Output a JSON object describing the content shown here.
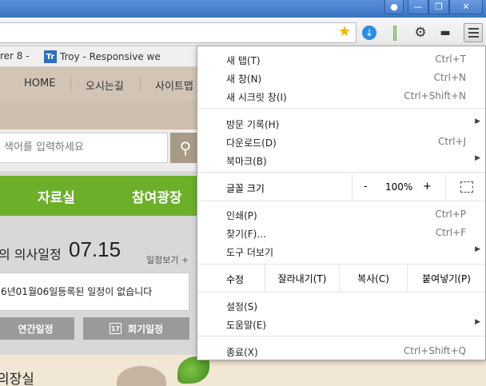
{
  "bookmarks": [
    {
      "label": "rer 8 -"
    },
    {
      "icon_text": "Tr",
      "label": "Troy - Responsive we"
    }
  ],
  "site": {
    "nav": [
      "HOME",
      "오시는길",
      "사이트맵"
    ],
    "search_placeholder": "색어를 입력하세요",
    "green_menu": [
      "자료실",
      "참여광장"
    ],
    "agenda": {
      "title": "의 의사일정",
      "date": "07.15",
      "more": "일정보기 +",
      "message": "6년01월06일등록된 일정이 없습니다",
      "btn_annual": "연간일정",
      "btn_session": "회기일정",
      "cal_num": "17"
    },
    "bottom_title": "의장실"
  },
  "menu": {
    "new_tab": {
      "label": "새 탭(T)",
      "shortcut": "Ctrl+T"
    },
    "new_window": {
      "label": "새 창(N)",
      "shortcut": "Ctrl+N"
    },
    "incognito": {
      "label": "새 시크릿 창(I)",
      "shortcut": "Ctrl+Shift+N"
    },
    "history": {
      "label": "방문 기록(H)"
    },
    "downloads": {
      "label": "다운로드(D)",
      "shortcut": "Ctrl+J"
    },
    "bookmarks": {
      "label": "북마크(B)"
    },
    "zoom": {
      "label": "글꼴 크기",
      "minus": "-",
      "value": "100%",
      "plus": "+"
    },
    "print": {
      "label": "인쇄(P)",
      "shortcut": "Ctrl+P"
    },
    "find": {
      "label": "찾기(F)...",
      "shortcut": "Ctrl+F"
    },
    "more_tools": {
      "label": "도구 더보기"
    },
    "edit": {
      "label": "수정",
      "cut": "잘라내기(T)",
      "copy": "복사(C)",
      "paste": "붙여넣기(P)"
    },
    "settings": {
      "label": "설정(S)"
    },
    "help": {
      "label": "도움말(E)"
    },
    "exit": {
      "label": "종료(X)",
      "shortcut": "Ctrl+Shift+Q"
    }
  }
}
